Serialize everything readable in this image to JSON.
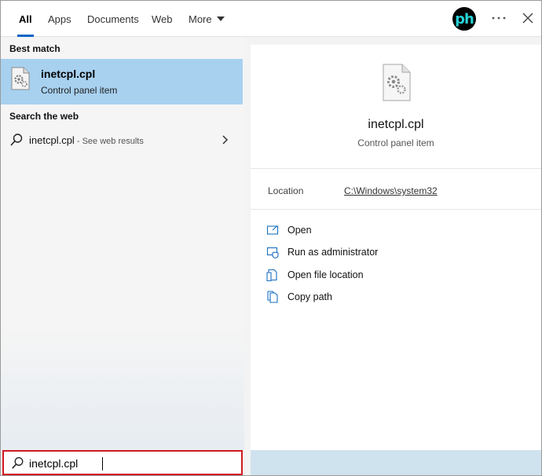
{
  "tabs": [
    {
      "label": "All"
    },
    {
      "label": "Apps"
    },
    {
      "label": "Documents"
    },
    {
      "label": "Web"
    },
    {
      "label": "More"
    }
  ],
  "header": {
    "avatar_text": "ph",
    "avatar_icon": "profile-avatar",
    "menu_icon": "ellipsis-icon",
    "close_icon": "close-icon"
  },
  "results": {
    "best_match_label": "Best match",
    "best_match": {
      "title": "inetcpl.cpl",
      "subtitle": "Control panel item",
      "icon": "control-panel-file-icon"
    },
    "web_label": "Search the web",
    "web_result": {
      "query": "inetcpl.cpl",
      "suffix": " - See web results",
      "icon": "search-icon"
    }
  },
  "detail": {
    "title": "inetcpl.cpl",
    "subtitle": "Control panel item",
    "location_label": "Location",
    "location_value": "C:\\Windows\\system32",
    "actions": [
      {
        "label": "Open",
        "icon": "open-window-icon"
      },
      {
        "label": "Run as administrator",
        "icon": "shield-window-icon"
      },
      {
        "label": "Open file location",
        "icon": "file-location-icon"
      },
      {
        "label": "Copy path",
        "icon": "copy-icon"
      }
    ]
  },
  "search": {
    "value": "inetcpl.cpl",
    "icon": "search-icon"
  },
  "colors": {
    "accent": "#0a64c8",
    "selection": "#a8d1f0",
    "highlight_border": "#d01a22",
    "avatar_text": "#27d3d8"
  }
}
